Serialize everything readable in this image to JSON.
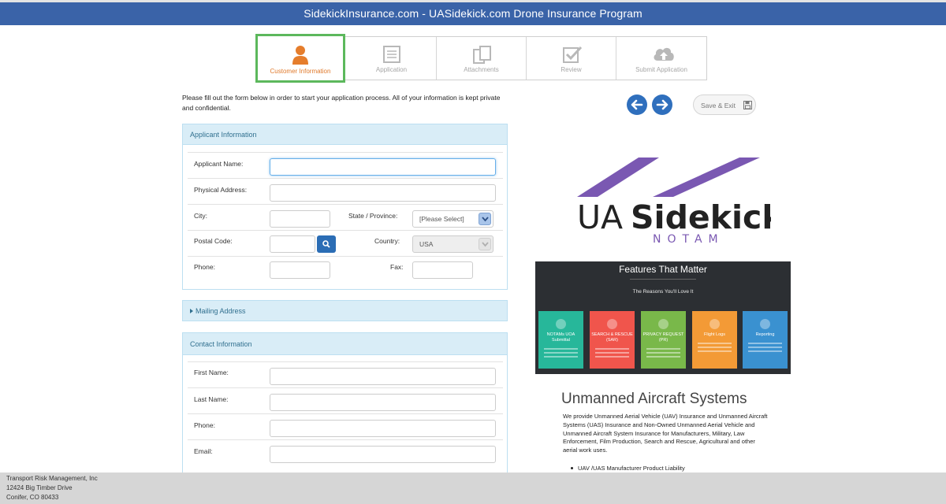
{
  "header": {
    "title": "SidekickInsurance.com - UASidekick.com Drone Insurance Program"
  },
  "steps": [
    {
      "label": "Customer Information",
      "icon": "user-icon",
      "active": true
    },
    {
      "label": "Application",
      "icon": "document-icon",
      "active": false
    },
    {
      "label": "Attachments",
      "icon": "copy-icon",
      "active": false
    },
    {
      "label": "Review",
      "icon": "checkbox-icon",
      "active": false
    },
    {
      "label": "Submit Application",
      "icon": "cloud-upload-icon",
      "active": false
    }
  ],
  "intro": "Please fill out the form below in order to start your application process. All of your information is kept private and confidential.",
  "actions": {
    "save_label": "Save & Exit",
    "back_icon": "arrow-left-icon",
    "next_icon": "arrow-right-icon",
    "save_icon": "floppy-disk-icon"
  },
  "applicant": {
    "heading": "Applicant Information",
    "name_label": "Applicant Name:",
    "address_label": "Physical Address:",
    "city_label": "City:",
    "state_label": "State / Province:",
    "state_value": "[Please Select]",
    "postal_label": "Postal Code:",
    "country_label": "Country:",
    "country_value": "USA",
    "phone_label": "Phone:",
    "fax_label": "Fax:"
  },
  "mailing": {
    "heading": "Mailing Address"
  },
  "contact": {
    "heading": "Contact Information",
    "first_label": "First Name:",
    "last_label": "Last Name:",
    "phone_label": "Phone:",
    "email_label": "Email:"
  },
  "promo": {
    "logo_main": "UASidekick",
    "logo_sub": "NOTAM",
    "features_title": "Features That Matter",
    "features_subtitle": "The Reasons You'll Love It",
    "tiles": [
      {
        "title": "NOTAMs UOA Submittal",
        "color": "#27b79a"
      },
      {
        "title": "SEARCH & RESCUE (SAR)",
        "color": "#f0554c"
      },
      {
        "title": "PRIVACY REQUEST (PR)",
        "color": "#79b84a"
      },
      {
        "title": "Flight Logs",
        "color": "#f39a36"
      },
      {
        "title": "Reporting",
        "color": "#3a91d0"
      }
    ],
    "heading": "Unmanned Aircraft Systems",
    "text": "We provide Unmanned Aerial Vehicle (UAV) Insurance and Unmanned Aircraft Systems (UAS) Insurance and Non-Owned Unmanned Aerial Vehicle and Unmanned Aircraft System Insurance for Manufacturers, Military, Law Enforcement, Film Production, Search and Rescue, Agricultural and other aerial work uses.",
    "bullet": "UAV /UAS Manufacturer Product Liability"
  },
  "footer": {
    "line1": "Transport Risk Management, Inc",
    "line2": "12424 Big Timber Drive",
    "line3": "Conifer, CO 80433"
  },
  "colors": {
    "header": "#3a63a8",
    "active_step_border": "#5cb85c",
    "active_step_text": "#e0792b",
    "panel_heading": "#d9edf7",
    "nav_button": "#2f6fbd"
  }
}
